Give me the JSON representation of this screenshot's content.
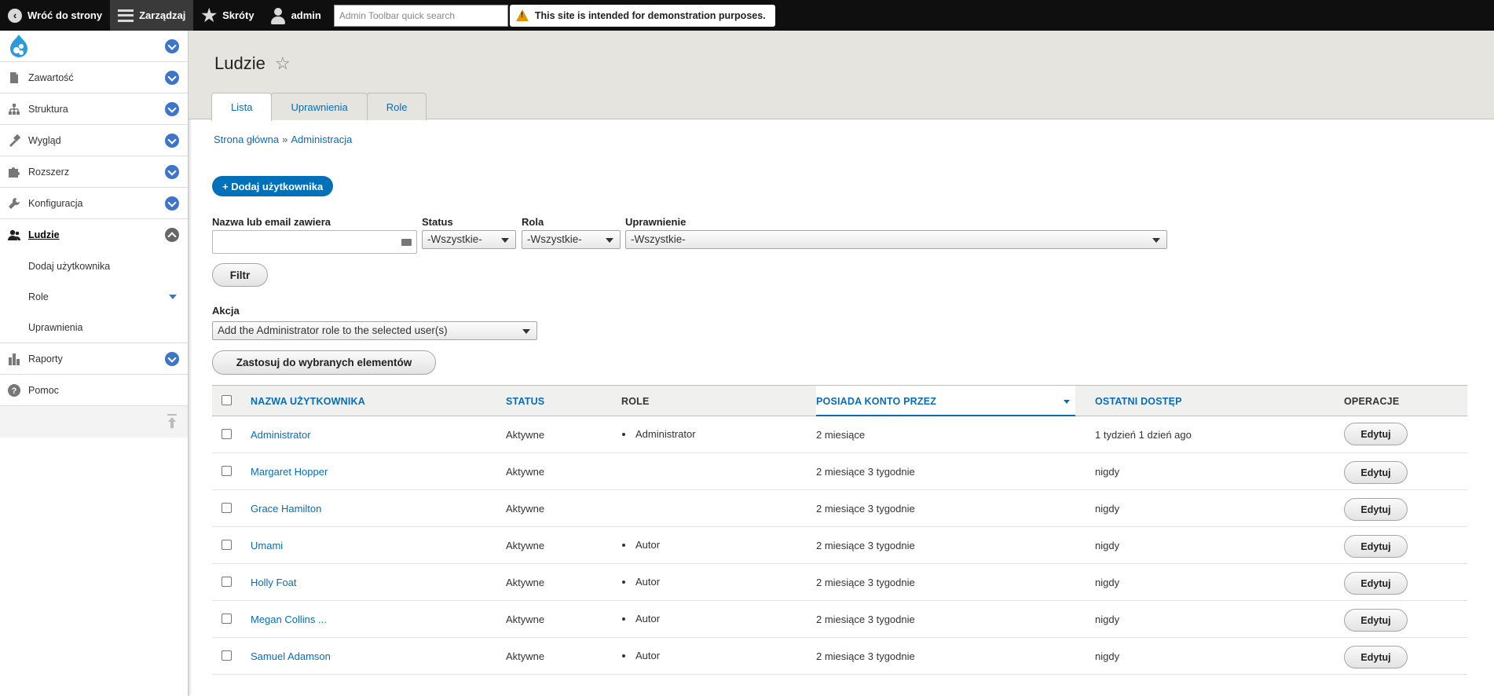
{
  "toolbar": {
    "back": "Wróć do strony",
    "manage": "Zarządzaj",
    "shortcuts": "Skróty",
    "user": "admin",
    "search_placeholder": "Admin Toolbar quick search",
    "notice": "This site is intended for demonstration purposes."
  },
  "sidebar": {
    "items": [
      {
        "label": "Zawartość",
        "icon": "file-icon"
      },
      {
        "label": "Struktura",
        "icon": "sitemap-icon"
      },
      {
        "label": "Wygląd",
        "icon": "brush-icon"
      },
      {
        "label": "Rozszerz",
        "icon": "puzzle-icon"
      },
      {
        "label": "Konfiguracja",
        "icon": "wrench-icon"
      },
      {
        "label": "Ludzie",
        "icon": "people-icon"
      }
    ],
    "subitems": [
      {
        "label": "Dodaj użytkownika"
      },
      {
        "label": "Role"
      },
      {
        "label": "Uprawnienia"
      }
    ],
    "after": [
      {
        "label": "Raporty",
        "icon": "bar-chart-icon"
      },
      {
        "label": "Pomoc",
        "icon": "help-icon"
      }
    ]
  },
  "page": {
    "title": "Ludzie",
    "tabs": [
      "Lista",
      "Uprawnienia",
      "Role"
    ],
    "breadcrumb": [
      "Strona główna",
      "»",
      "Administracja"
    ],
    "add_user": "+ Dodaj użytkownika"
  },
  "filters": {
    "name_label": "Nazwa lub email zawiera",
    "status_label": "Status",
    "status_value": "-Wszystkie-",
    "role_label": "Rola",
    "role_value": "-Wszystkie-",
    "permission_label": "Uprawnienie",
    "permission_value": "-Wszystkie-",
    "filter_button": "Filtr",
    "action_label": "Akcja",
    "action_value": "Add the Administrator role to the selected user(s)",
    "apply_button": "Zastosuj do wybranych elementów"
  },
  "table": {
    "headers": {
      "username": "NAZWA UŻYTKOWNIKA",
      "status": "STATUS",
      "roles": "ROLE",
      "member_for": "POSIADA KONTO PRZEZ",
      "last_access": "OSTATNI DOSTĘP",
      "operations": "OPERACJE"
    },
    "edit_label": "Edytuj",
    "rows": [
      {
        "name": "Administrator",
        "status": "Aktywne",
        "role": "Administrator",
        "member_for": "2 miesiące",
        "last_access": "1 tydzień 1 dzień ago"
      },
      {
        "name": "Margaret Hopper",
        "status": "Aktywne",
        "role": "",
        "member_for": "2 miesiące 3 tygodnie",
        "last_access": "nigdy"
      },
      {
        "name": "Grace Hamilton",
        "status": "Aktywne",
        "role": "",
        "member_for": "2 miesiące 3 tygodnie",
        "last_access": "nigdy"
      },
      {
        "name": "Umami",
        "status": "Aktywne",
        "role": "Autor",
        "member_for": "2 miesiące 3 tygodnie",
        "last_access": "nigdy"
      },
      {
        "name": "Holly Foat",
        "status": "Aktywne",
        "role": "Autor",
        "member_for": "2 miesiące 3 tygodnie",
        "last_access": "nigdy"
      },
      {
        "name": "Megan Collins ...",
        "status": "Aktywne",
        "role": "Autor",
        "member_for": "2 miesiące 3 tygodnie",
        "last_access": "nigdy"
      },
      {
        "name": "Samuel Adamson",
        "status": "Aktywne",
        "role": "Autor",
        "member_for": "2 miesiące 3 tygodnie",
        "last_access": "nigdy"
      }
    ]
  },
  "colors": {
    "accent": "#0071b8",
    "link": "#0a6cb2",
    "toolbar": "#0f0f0f",
    "warning": "#e09600"
  }
}
